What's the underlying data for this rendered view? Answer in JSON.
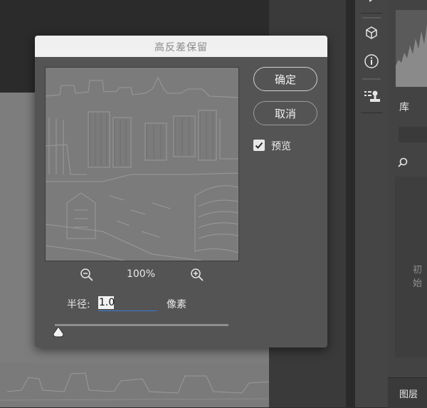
{
  "dialog": {
    "title": "高反差保留",
    "ok_label": "确定",
    "cancel_label": "取消",
    "preview_label": "预览",
    "preview_checked": true,
    "zoom_level": "100%",
    "radius_label": "半径:",
    "radius_value": "1.0",
    "radius_unit": "像素",
    "radius_slider_fraction": 0.02
  },
  "right_panel": {
    "library_label": "库",
    "library_empty_text": "初始",
    "layers_label": "图层"
  },
  "icons": {
    "zoom_out": "zoom-out-icon",
    "zoom_in": "zoom-in-icon",
    "info": "info-icon",
    "cube": "3d-cube-icon",
    "stamp": "clone-source-icon",
    "search": "search-icon",
    "checkbox": "checkmark-icon"
  }
}
